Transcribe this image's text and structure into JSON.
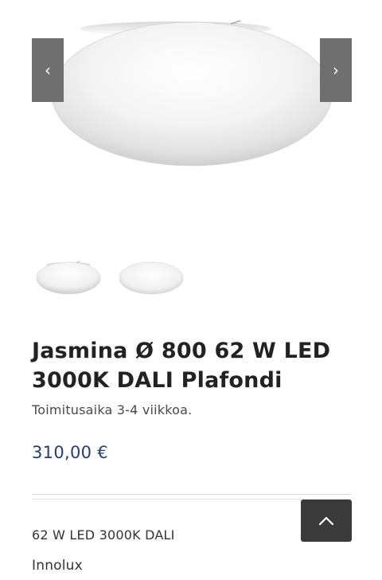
{
  "gallery": {
    "prev_icon": "chevron-left-icon",
    "prev_glyph": "‹",
    "next_icon": "chevron-right-icon",
    "next_glyph": "›",
    "thumbnail_count": 2
  },
  "product": {
    "title": "Jasmina Ø 800 62 W LED 3000K DALI Plafondi",
    "delivery": "Toimitusaika 3-4 viikkoa.",
    "price": "310,00 €",
    "spec": "62 W LED 3000K DALI",
    "brand": "Innolux"
  },
  "scroll_top": {
    "icon": "chevron-up-icon"
  },
  "colors": {
    "price": "#243d7a",
    "nav_button": "#6f6f6f",
    "scroll_top_button": "#3a3a3a",
    "title": "#222222"
  }
}
